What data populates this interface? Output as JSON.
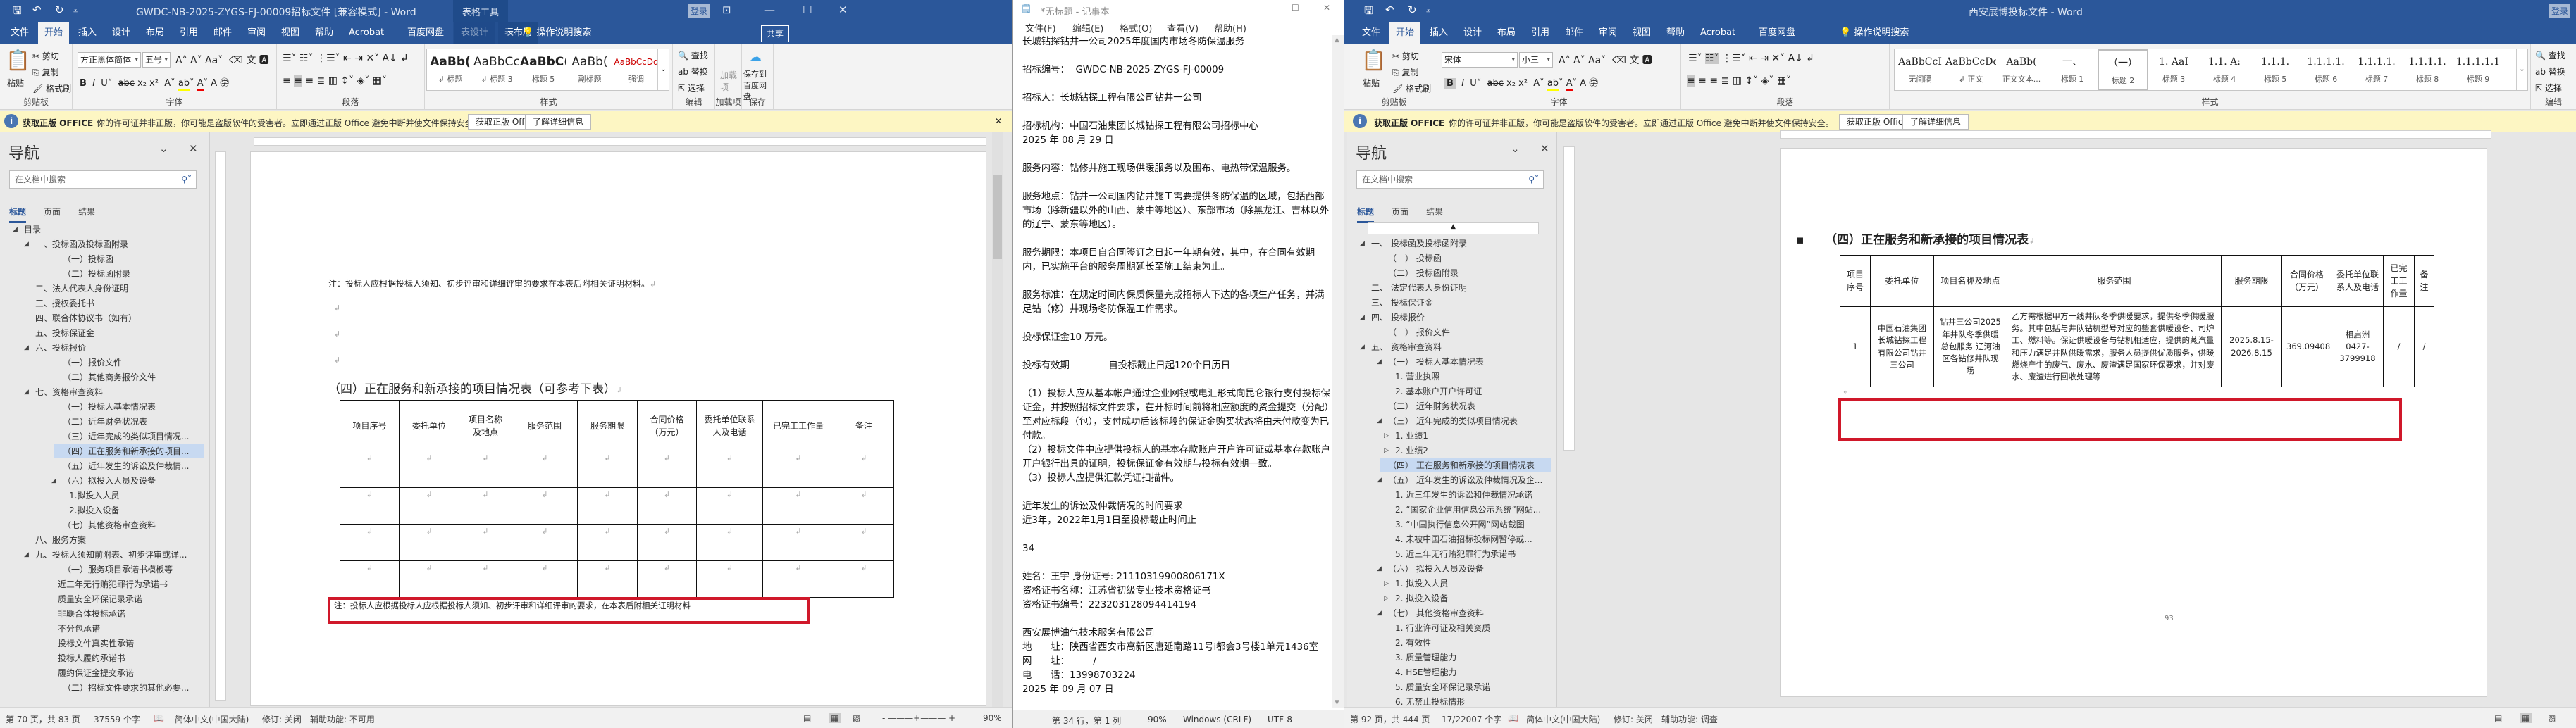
{
  "left_word": {
    "title": "GWDC-NB-2025-ZYGS-FJ-00009招标文件 [兼容模式]  -  Word",
    "context_tab_group": "表格工具",
    "login": "登录",
    "share": "共享",
    "tabs": [
      "文件",
      "开始",
      "插入",
      "设计",
      "布局",
      "引用",
      "邮件",
      "审阅",
      "视图",
      "帮助",
      "Acrobat",
      "百度网盘",
      "表设计",
      "表布局"
    ],
    "tell_me": "操作说明搜索",
    "clipboard": {
      "paste": "粘贴",
      "cut": "剪切",
      "copy": "复制",
      "format_painter": "格式刷",
      "label": "剪贴板"
    },
    "font": {
      "name": "方正黑体简体",
      "size": "五号",
      "label": "字体"
    },
    "paragraph_label": "段落",
    "styles": [
      {
        "sample": "AaBb(",
        "name": "↲ 标题"
      },
      {
        "sample": "AaBbCcI",
        "name": "↲ 标题 3"
      },
      {
        "sample": "AaBbC(",
        "name": "标题 5"
      },
      {
        "sample": "AaBb(",
        "name": "副标题"
      },
      {
        "sample": "AaBbCcDd",
        "name": "强调"
      }
    ],
    "styles_label": "样式",
    "editing": {
      "find": "查找",
      "replace": "替换",
      "select": "选择",
      "label": "编辑"
    },
    "addins": {
      "button": "加载项",
      "label": "加载项"
    },
    "save": {
      "button": "保存到百度网盘",
      "label": "保存"
    },
    "nav": {
      "title": "导航",
      "search_placeholder": "在文档中搜索",
      "tabs": [
        "标题",
        "页面",
        "结果"
      ],
      "items": [
        {
          "t": "目录",
          "l": 0,
          "e": 1
        },
        {
          "t": "一、投标函及投标函附录",
          "l": 1,
          "e": 1
        },
        {
          "t": "（一）投标函",
          "l": 3
        },
        {
          "t": "（二）投标函附录",
          "l": 3
        },
        {
          "t": "二、法人代表人身份证明",
          "l": 1
        },
        {
          "t": "三、授权委托书",
          "l": 1
        },
        {
          "t": "四、联合体协议书（如有）",
          "l": 1
        },
        {
          "t": "五、投标保证金",
          "l": 1
        },
        {
          "t": "六、投标报价",
          "l": 1,
          "e": 1
        },
        {
          "t": "（一）报价文件",
          "l": 3
        },
        {
          "t": "（二）其他商务报价文件",
          "l": 3
        },
        {
          "t": "七、资格审查资料",
          "l": 1,
          "e": 1
        },
        {
          "t": "（一）投标人基本情况表",
          "l": 3
        },
        {
          "t": "（二）近年财务状况表",
          "l": 3
        },
        {
          "t": "（三）近年完成的类似项目情况...",
          "l": 3
        },
        {
          "t": "（四）正在服务和新承接的项目...",
          "l": 3,
          "sel": 1
        },
        {
          "t": "（五）近年发生的诉讼及仲裁情...",
          "l": 3
        },
        {
          "t": "（六）拟投入人员及设备",
          "l": 3,
          "e": 1
        },
        {
          "t": "1.拟投入人员",
          "l": 4
        },
        {
          "t": "2.拟投入设备",
          "l": 4
        },
        {
          "t": "（七）其他资格审查资料",
          "l": 3
        },
        {
          "t": "八、服务方案",
          "l": 1
        },
        {
          "t": "九、投标人须知前附表、初步评审或详...",
          "l": 1,
          "e": 1
        },
        {
          "t": "（一）服务项目承诺书模板等",
          "l": 3
        },
        {
          "t": "近三年无行贿犯罪行为承诺书",
          "l": 2
        },
        {
          "t": "质量安全环保记录承诺",
          "l": 2
        },
        {
          "t": "非联合体投标承诺",
          "l": 2
        },
        {
          "t": "不分包承诺",
          "l": 2
        },
        {
          "t": "投标文件真实性承诺",
          "l": 2
        },
        {
          "t": "投标人履约承诺书",
          "l": 2
        },
        {
          "t": "履约保证金提交承诺",
          "l": 2
        },
        {
          "t": "（二）招标文件要求的其他必要...",
          "l": 3
        }
      ]
    },
    "doc": {
      "note_top": "注：投标人应根据投标人须知、初步评审和详细评审的要求在本表后附相关证明材料。",
      "heading": "（四）正在服务和新承接的项目情况表（可参考下表）",
      "table_headers": [
        "项目序号",
        "委托单位",
        "项目名称及地点",
        "服务范围",
        "服务期限",
        "合同价格（万元）",
        "委托单位联系人及电话",
        "已完工工作量",
        "备注"
      ],
      "empty_rows": 4,
      "note_bottom": "注：投标人应根据投标人应根据投标人须知、初步评审和详细评审的要求，在本表后附相关证明材料"
    },
    "status": {
      "page": "第 70 页，共 83 页",
      "words": "37559 个字",
      "lang": "简体中文(中国大陆)",
      "track": "修订: 关闭",
      "access": "辅助功能: 不可用",
      "zoom": "90%"
    }
  },
  "notepad": {
    "title": "*无标题 - 记事本",
    "menu": [
      "文件(F)",
      "编辑(E)",
      "格式(O)",
      "查看(V)",
      "帮助(H)"
    ],
    "lines": [
      "长城钻探钻井一公司2025年度国内市场冬防保温服务",
      "",
      "招标编号：  GWDC-NB-2025-ZYGS-FJ-00009",
      "",
      "招标人：长城钻探工程有限公司钻井一公司",
      "",
      "招标机构：中国石油集团长城钻探工程有限公司招标中心",
      "2025 年 08 月 29 日",
      "",
      "服务内容：钻修井施工现场供暖服务以及围布、电热带保温服务。",
      "",
      "服务地点：钻井一公司国内钻井施工需要提供冬防保温的区域，包括西部市场（除新疆以外的山西、蒙中等地区）、东部市场（除黑龙江、吉林以外的辽宁、蒙东等地区）。",
      "",
      "服务期限：本项目自合同签订之日起一年期有效，其中，在合同有效期内，已实施平台的服务周期延长至施工结束为止。",
      "",
      "服务标准：在规定时间内保质保量完成招标人下达的各项生产任务，并满足钻（修）井现场冬防保温工作需求。",
      "",
      "投标保证金10 万元。",
      "",
      "投标有效期             自投标截止日起120个日历日",
      "",
      "（1）投标人应从基本帐户通过企业网银或电汇形式向昆仑银行支付投标保证金，并按照招标文件要求，在开标时间前将相应额度的资金提交（分配）至对应标段（包），支付成功后该标段的保证金购买状态将由未付款变为已付款。",
      "（2）投标文件中应提供投标人的基本存款账户开户许可证或基本存款账户开户银行出具的证明，投标保证金有效期与投标有效期一致。",
      "（3）投标人应提供汇款凭证扫描件。",
      "",
      "近年发生的诉讼及仲裁情况的时间要求",
      "近3年，2022年1月1日至投标截止时间止",
      "",
      "34",
      "",
      "姓名：王宇 身份证号: 21110319900806171X",
      "资格证书名称：江苏省初级专业技术资格证书",
      "资格证书编号：223203128094414194",
      "",
      "西安展博油气技术服务有限公司",
      "地　　址：陕西省西安市高新区唐延南路11号i都会3号楼1单元1436室",
      "网　　址：　　　/",
      "电　　话：13998703224",
      "2025 年 09 月 07 日"
    ],
    "status": {
      "position": "第 34 行，第 1 列",
      "zoom": "90%",
      "eol": "Windows (CRLF)",
      "encoding": "UTF-8"
    }
  },
  "right_word": {
    "title": "西安展博投标文件  -  Word",
    "login": "登录",
    "tabs": [
      "文件",
      "开始",
      "插入",
      "设计",
      "布局",
      "引用",
      "邮件",
      "审阅",
      "视图",
      "帮助",
      "Acrobat",
      "百度网盘"
    ],
    "tell_me": "操作说明搜索",
    "clipboard": {
      "paste": "粘贴",
      "cut": "剪切",
      "copy": "复制",
      "format_painter": "格式刷",
      "label": "剪贴板"
    },
    "font": {
      "name": "宋体",
      "size": "小三",
      "label": "字体"
    },
    "paragraph_label": "段落",
    "styles": [
      {
        "sample": "AaBbCcI",
        "name": "无间隔"
      },
      {
        "sample": "AaBbCcDdI",
        "name": "↲ 正文"
      },
      {
        "sample": "AaBb(",
        "name": "正文文本..."
      },
      {
        "sample": "一、",
        "name": "标题 1"
      },
      {
        "sample": "（一）",
        "name": "标题 2",
        "sel": 1
      },
      {
        "sample": "1.  AaI",
        "name": "标题 3"
      },
      {
        "sample": "1.1.  A:",
        "name": "标题 4"
      },
      {
        "sample": "1.1.1.",
        "name": "标题 5"
      },
      {
        "sample": "1.1.1.1.",
        "name": "标题 6"
      },
      {
        "sample": "1.1.1.1.",
        "name": "标题 7"
      },
      {
        "sample": "1.1.1.1.",
        "name": "标题 8"
      },
      {
        "sample": "1.1.1.1.1",
        "name": "标题 9"
      }
    ],
    "styles_label": "样式",
    "editing": {
      "find": "查找",
      "replace": "替换",
      "select": "选择",
      "label": "编辑"
    },
    "nav": {
      "title": "导航",
      "search_placeholder": "在文档中搜索",
      "tabs": [
        "标题",
        "页面",
        "结果"
      ],
      "items": [
        {
          "t": "一、  投标函及投标函附录",
          "l": 1,
          "e": 1
        },
        {
          "t": "（一）  投标函",
          "l": 3
        },
        {
          "t": "（二）  投标函附录",
          "l": 3
        },
        {
          "t": "二、  法定代表人身份证明",
          "l": 1
        },
        {
          "t": "三、  投标保证金",
          "l": 1
        },
        {
          "t": "四、  投标报价",
          "l": 1,
          "e": 1
        },
        {
          "t": "（一）  报价文件",
          "l": 3
        },
        {
          "t": "五、  资格审查资料",
          "l": 1,
          "e": 1
        },
        {
          "t": "（一）  投标人基本情况表",
          "l": 3,
          "e": 1
        },
        {
          "t": "1. 营业执照",
          "l": 4
        },
        {
          "t": "2. 基本账户开户许可证",
          "l": 4
        },
        {
          "t": "（二）  近年财务状况表",
          "l": 3
        },
        {
          "t": "（三）  近年完成的类似项目情况表",
          "l": 3,
          "e": 1
        },
        {
          "t": "1. 业绩1",
          "l": 4,
          "c": 1
        },
        {
          "t": "2. 业绩2",
          "l": 4,
          "c": 1
        },
        {
          "t": "（四）  正在服务和新承接的项目情况表",
          "l": 3,
          "sel": 1
        },
        {
          "t": "（五）  近年发生的诉讼及仲裁情况及企...",
          "l": 3,
          "e": 1
        },
        {
          "t": "1. 近三年发生的诉讼和仲裁情况承诺",
          "l": 4
        },
        {
          "t": "2. “国家企业信用信息公示系统”网站...",
          "l": 4
        },
        {
          "t": "3. “中国执行信息公开网”网站截图",
          "l": 4
        },
        {
          "t": "4. 未被中国石油招标投标网暂停或...",
          "l": 4
        },
        {
          "t": "5. 近三年无行贿犯罪行为承诺书",
          "l": 4
        },
        {
          "t": "（六）  拟投入人员及设备",
          "l": 3,
          "e": 1
        },
        {
          "t": "1. 拟投入人员",
          "l": 4,
          "c": 1
        },
        {
          "t": "2. 拟投入设备",
          "l": 4,
          "c": 1
        },
        {
          "t": "（七）  其他资格审查资料",
          "l": 3,
          "e": 1
        },
        {
          "t": "1. 行业许可证及相关资质",
          "l": 4
        },
        {
          "t": "2. 有效性",
          "l": 4
        },
        {
          "t": "3. 质量管理能力",
          "l": 4
        },
        {
          "t": "4. HSE管理能力",
          "l": 4
        },
        {
          "t": "5. 质量安全环保记录承诺",
          "l": 4
        },
        {
          "t": "6. 无禁止投标情形",
          "l": 4
        }
      ]
    },
    "doc": {
      "heading": "（四）正在服务和新承接的项目情况表",
      "table_headers": [
        "项目序号",
        "委托单位",
        "项目名称及地点",
        "服务范围",
        "服务期限",
        "合同价格（万元）",
        "委托单位联系人及电话",
        "已完工工作量",
        "备注"
      ],
      "rows": [
        [
          "1",
          "中国石油集团长城钻探工程有限公司钻井三公司",
          "钻井三公司2025年井队冬季供暖总包服务 辽河油区各钻修井队现场",
          "乙方需根据甲方一线井队冬季供暖要求，提供冬季供暖服务。其中包括与井队钻机型号对应的整套供暖设备、司炉工、燃料等。保证供暖设备与钻机相适应，提供的蒸汽量和压力满足井队供暖需求，服务人员提供优质服务，供暖燃烧产生的废气、废水、废渣满足国家环保要求，并对废水、废渣进行回收处理等",
          "2025.8.15-2026.8.15",
          "369.09408",
          "相启洲 0427-3799918",
          "/",
          "/"
        ]
      ],
      "page_number": "93"
    },
    "status": {
      "page": "第 92 页，共 444 页",
      "words": "17/22007 个字",
      "lang": "简体中文(中国大陆)",
      "track": "修订: 关闭",
      "access": "辅助功能: 调查"
    }
  },
  "msgbar": {
    "title": "获取正版 OFFICE",
    "text": "你的许可证并非正版，你可能是盗版软件的受害者。立即通过正版 Office 避免中断并使文件保持安全。",
    "get_button": "获取正版 Office",
    "learn_button": "了解详细信息"
  },
  "colors": {
    "word_blue": "#2b579a",
    "message_bar": "#fdf6c3",
    "highlight_red": "#d0182a",
    "nav_selected": "#c7d9f1"
  }
}
